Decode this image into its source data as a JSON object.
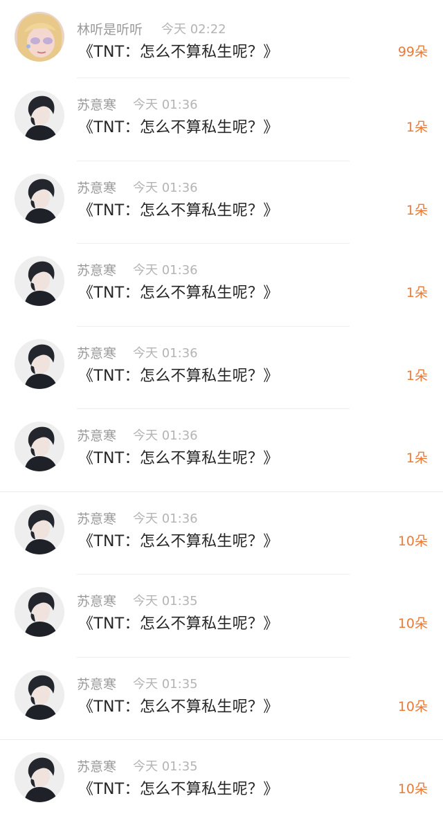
{
  "colors": {
    "count": "#ea7a36",
    "name": "#9a9a9a",
    "time": "#b4b4b4",
    "title": "#262626"
  },
  "gifts": [
    {
      "name": "林听是听听",
      "time": "今天 02:22",
      "title": "《TNT：怎么不算私生呢？》",
      "count": "99朵",
      "avatar": "blonde-girl-avatar"
    },
    {
      "name": "苏意寒",
      "time": "今天 01:36",
      "title": "《TNT：怎么不算私生呢？》",
      "count": "1朵",
      "avatar": "dark-hair-boy-avatar"
    },
    {
      "name": "苏意寒",
      "time": "今天 01:36",
      "title": "《TNT：怎么不算私生呢？》",
      "count": "1朵",
      "avatar": "dark-hair-boy-avatar"
    },
    {
      "name": "苏意寒",
      "time": "今天 01:36",
      "title": "《TNT：怎么不算私生呢？》",
      "count": "1朵",
      "avatar": "dark-hair-boy-avatar"
    },
    {
      "name": "苏意寒",
      "time": "今天 01:36",
      "title": "《TNT：怎么不算私生呢？》",
      "count": "1朵",
      "avatar": "dark-hair-boy-avatar"
    },
    {
      "name": "苏意寒",
      "time": "今天 01:36",
      "title": "《TNT：怎么不算私生呢？》",
      "count": "1朵",
      "avatar": "dark-hair-boy-avatar"
    },
    {
      "name": "苏意寒",
      "time": "今天 01:36",
      "title": "《TNT：怎么不算私生呢？》",
      "count": "10朵",
      "avatar": "dark-hair-boy-avatar"
    },
    {
      "name": "苏意寒",
      "time": "今天 01:35",
      "title": "《TNT：怎么不算私生呢？》",
      "count": "10朵",
      "avatar": "dark-hair-boy-avatar"
    },
    {
      "name": "苏意寒",
      "time": "今天 01:35",
      "title": "《TNT：怎么不算私生呢？》",
      "count": "10朵",
      "avatar": "dark-hair-boy-avatar"
    },
    {
      "name": "苏意寒",
      "time": "今天 01:35",
      "title": "《TNT：怎么不算私生呢？》",
      "count": "10朵",
      "avatar": "dark-hair-boy-avatar"
    }
  ]
}
